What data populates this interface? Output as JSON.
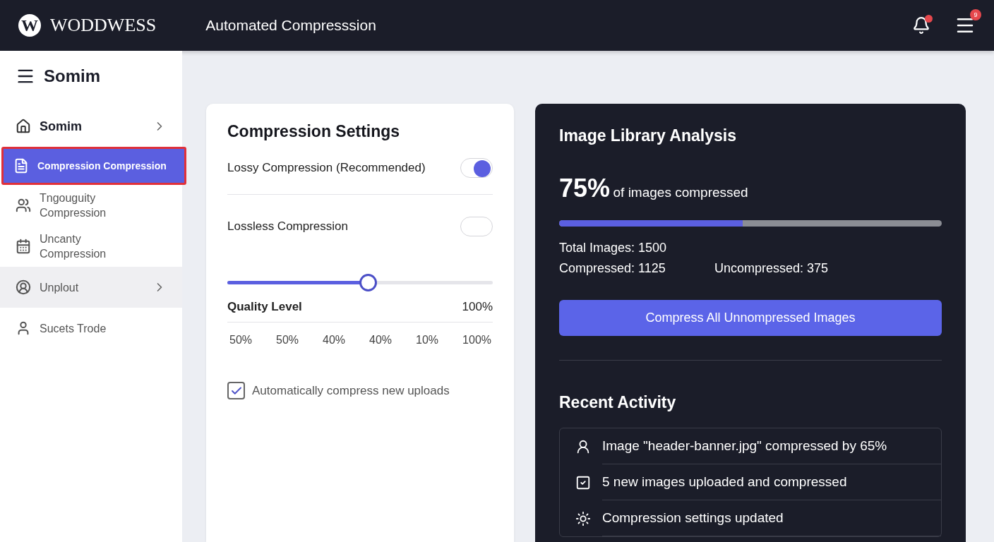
{
  "header": {
    "logo_letter": "W",
    "brand": "WODDWESS",
    "title": "Automated Compresssion",
    "notifications": {
      "dot": true
    },
    "menu": {
      "badge": "9"
    }
  },
  "sidebar": {
    "title": "Somim",
    "items": [
      {
        "label": "Somim",
        "chevron": true,
        "selected": false,
        "highlighted": false
      },
      {
        "label": "Compression Compression",
        "chevron": false,
        "selected": true,
        "highlighted": false
      },
      {
        "label": "Tngouguity Compression",
        "chevron": false,
        "selected": false,
        "highlighted": false
      },
      {
        "label": "Uncanty Compression",
        "chevron": false,
        "selected": false,
        "highlighted": false
      },
      {
        "label": "Unplout",
        "chevron": true,
        "selected": false,
        "highlighted": true
      },
      {
        "label": "Sucets Trode",
        "chevron": false,
        "selected": false,
        "highlighted": false
      }
    ]
  },
  "settings": {
    "title": "Compression Settings",
    "toggles": [
      {
        "label": "Lossy Compression (Recommended)",
        "on": true
      },
      {
        "label": "Lossless Compression",
        "on": false
      }
    ],
    "quality": {
      "label": "Quality Level",
      "value": "100%",
      "level": 0.53
    },
    "ticks": [
      "50%",
      "50%",
      "40%",
      "40%",
      "10%",
      "100%"
    ],
    "auto_compress": {
      "label": "Automatically compress new uploads",
      "checked": true
    }
  },
  "analysis": {
    "title": "Image Library Analysis",
    "percent": "75%",
    "percent_caption": "of images compressed",
    "level": 0.48,
    "total": "Total Images: 1500",
    "compressed": "Compressed: 1125",
    "uncompressed": "Uncompressed: 375",
    "button": "Compress All Unnompressed Images"
  },
  "recent_activity": {
    "title": "Recent Activity",
    "items": [
      {
        "kind": "user",
        "text": "Image \"header-banner.jpg\" compressed by 65%"
      },
      {
        "kind": "check",
        "text": "5 new images uploaded and compressed"
      },
      {
        "kind": "sun",
        "text": "Compression settings updated"
      }
    ]
  }
}
